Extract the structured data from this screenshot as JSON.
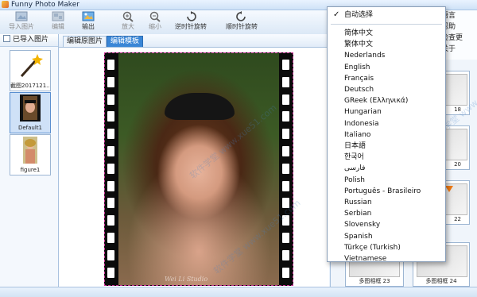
{
  "window": {
    "title": "Funny Photo Maker"
  },
  "toolbar": [
    {
      "label": "导入图片",
      "icon": "import-image-icon",
      "disabled": true
    },
    {
      "label": "编辑",
      "icon": "edit-icon",
      "disabled": true
    },
    {
      "label": "输出",
      "icon": "export-icon",
      "disabled": false
    },
    {
      "label": "放大",
      "icon": "zoom-in-icon",
      "disabled": true
    },
    {
      "label": "缩小",
      "icon": "zoom-out-icon",
      "disabled": true
    },
    {
      "label": "逆时针旋转",
      "icon": "rotate-ccw-icon",
      "disabled": false
    },
    {
      "label": "顺时针旋转",
      "icon": "rotate-cw-icon",
      "disabled": false
    }
  ],
  "left_panel": {
    "header": "已导入图片",
    "items": [
      {
        "caption": "截图2017121..."
      },
      {
        "caption": "Default1"
      },
      {
        "caption": "figure1"
      }
    ]
  },
  "tabs": [
    {
      "label": "编辑原图片",
      "active": false
    },
    {
      "label": "编辑模板",
      "active": true
    }
  ],
  "photo": {
    "signature": "Wei Li Studio"
  },
  "watermarks": [
    "软件学堂 www.xue51.com",
    "软件学堂 www.xue51.com",
    "软件学堂 www.xue51.com"
  ],
  "right_menu": [
    "语言",
    "帮助",
    "检查更",
    "关于"
  ],
  "templates": [
    {
      "caption": "18"
    },
    {
      "caption": "20"
    },
    {
      "caption": "22"
    },
    {
      "caption": "多图相框 23"
    },
    {
      "caption": "多图相框 24"
    }
  ],
  "language_menu": {
    "auto": "自动选择",
    "items": [
      "简体中文",
      "繁体中文",
      "Nederlands",
      "English",
      "Français",
      "Deutsch",
      "GReek (Ελληνικά)",
      "Hungarian",
      "Indonesia",
      "Italiano",
      "日本語",
      "한국어",
      "فارسی",
      "Polish",
      "Português - Brasileiro",
      "Russian",
      "Serbian",
      "Slovensky",
      "Spanish",
      "Türkçe (Turkish)",
      "Vietnamese"
    ]
  },
  "colors": {
    "accent": "#3a86d6",
    "arrow": "#f07a12",
    "filmstrip": "#0b0b0b"
  }
}
